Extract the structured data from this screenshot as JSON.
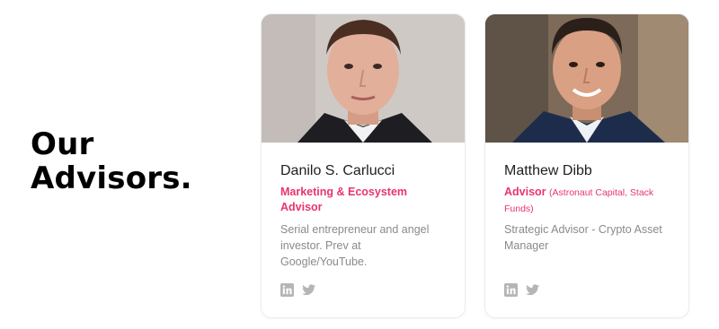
{
  "section": {
    "title_line1": "Our",
    "title_line2": "Advisors."
  },
  "advisors": [
    {
      "name": "Danilo S. Carlucci",
      "role": "Marketing & Ecosystem Advisor",
      "org": "",
      "bio": "Serial entrepreneur and angel investor. Prev at Google/YouTube.",
      "social": [
        "linkedin-icon",
        "twitter-icon"
      ]
    },
    {
      "name": "Matthew Dibb",
      "role": "Advisor",
      "org": "(Astronaut Capital, Stack Funds)",
      "bio": "Strategic Advisor - Crypto Asset Manager",
      "social": [
        "linkedin-icon",
        "twitter-icon"
      ]
    }
  ],
  "colors": {
    "accent": "#e8356d",
    "muted_text": "#8a8a8a",
    "icon": "#b5b5b5"
  }
}
